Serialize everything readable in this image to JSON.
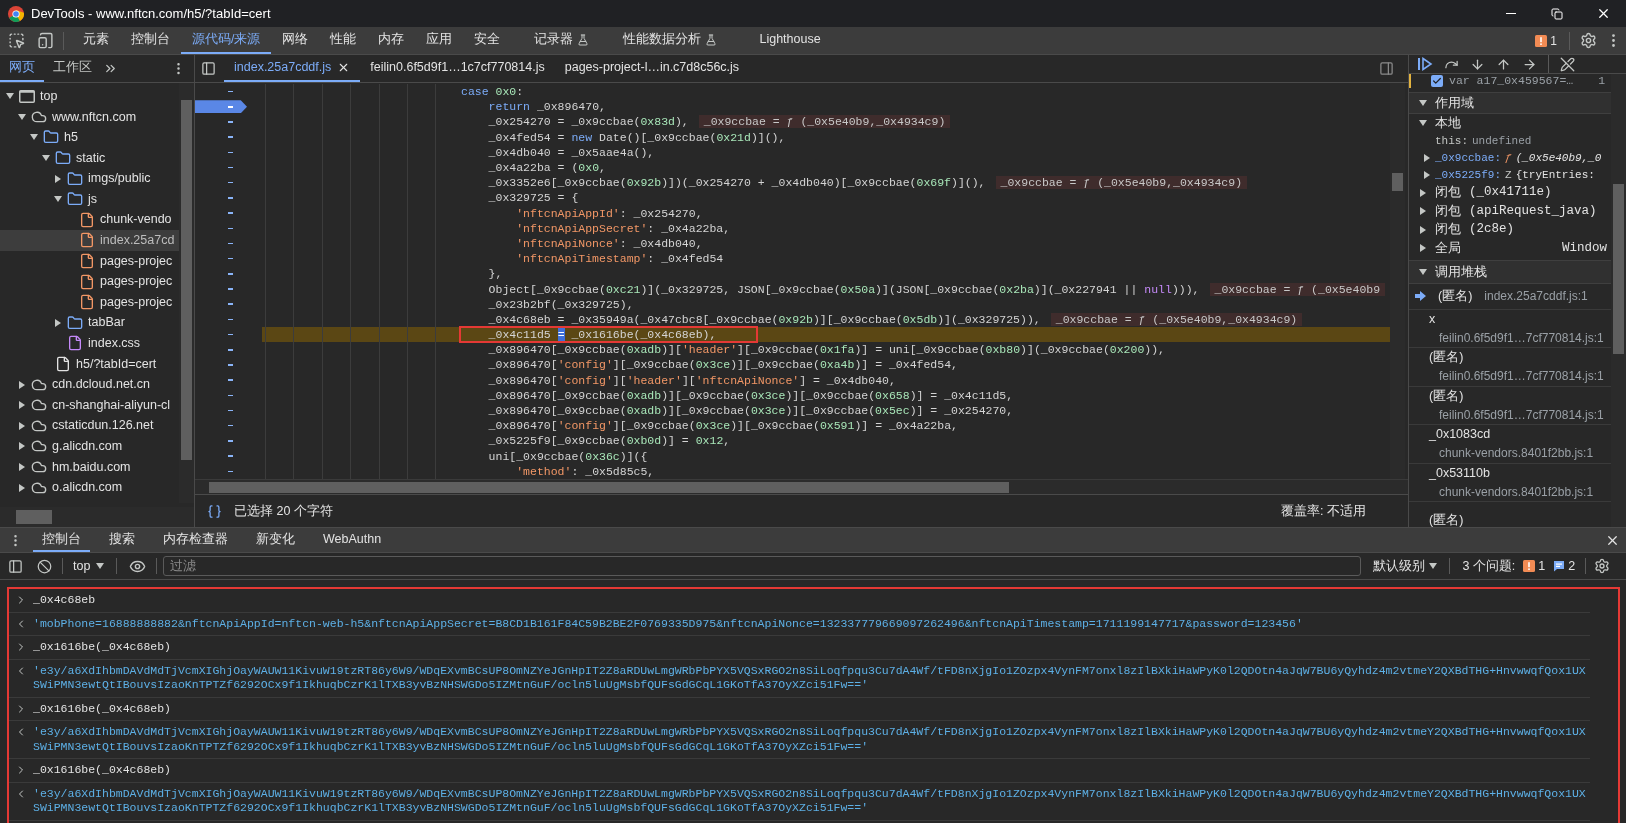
{
  "window": {
    "title": "DevTools - www.nftcn.com/h5/?tabId=cert"
  },
  "main_tabs": [
    {
      "label": "元素",
      "selected": false,
      "experimental": false
    },
    {
      "label": "控制台",
      "selected": false,
      "experimental": false
    },
    {
      "label": "源代码/来源",
      "selected": true,
      "experimental": false
    },
    {
      "label": "网络",
      "selected": false,
      "experimental": false
    },
    {
      "label": "性能",
      "selected": false,
      "experimental": false
    },
    {
      "label": "内存",
      "selected": false,
      "experimental": false
    },
    {
      "label": "应用",
      "selected": false,
      "experimental": false
    },
    {
      "label": "安全",
      "selected": false,
      "experimental": false
    },
    {
      "label": "记录器",
      "selected": false,
      "experimental": true
    },
    {
      "label": "性能数据分析",
      "selected": false,
      "experimental": true
    },
    {
      "label": "Lighthouse",
      "selected": false,
      "experimental": false
    }
  ],
  "issues_badge": {
    "count": "1"
  },
  "navigator": {
    "tabs": [
      {
        "label": "网页",
        "selected": true
      },
      {
        "label": "工作区",
        "selected": false
      }
    ],
    "tree": [
      {
        "kind": "frame",
        "label": "top",
        "expanded": true,
        "selected": false,
        "children": [
          {
            "kind": "domain",
            "label": "www.nftcn.com",
            "expanded": true,
            "selected": false,
            "children": [
              {
                "kind": "folder",
                "label": "h5",
                "expanded": true,
                "selected": false,
                "children": [
                  {
                    "kind": "folder",
                    "label": "static",
                    "expanded": true,
                    "selected": false,
                    "children": [
                      {
                        "kind": "folder",
                        "label": "imgs/public",
                        "expanded": false,
                        "selected": false
                      },
                      {
                        "kind": "folder",
                        "label": "js",
                        "expanded": true,
                        "selected": false,
                        "children": [
                          {
                            "kind": "script",
                            "label": "chunk-vendo",
                            "selected": false
                          },
                          {
                            "kind": "script",
                            "label": "index.25a7cd",
                            "selected": true
                          },
                          {
                            "kind": "script",
                            "label": "pages-projec",
                            "selected": false
                          },
                          {
                            "kind": "script",
                            "label": "pages-projec",
                            "selected": false
                          },
                          {
                            "kind": "script",
                            "label": "pages-projec",
                            "selected": false
                          }
                        ]
                      },
                      {
                        "kind": "folder",
                        "label": "tabBar",
                        "expanded": false,
                        "selected": false
                      },
                      {
                        "kind": "stylesheet",
                        "label": "index.css",
                        "selected": false
                      }
                    ]
                  },
                  {
                    "kind": "document",
                    "label": "h5/?tabId=cert",
                    "selected": false
                  }
                ]
              }
            ]
          },
          {
            "kind": "domain",
            "label": "cdn.dcloud.net.cn",
            "expanded": false,
            "selected": false
          },
          {
            "kind": "domain",
            "label": "cn-shanghai-aliyun-cl",
            "expanded": false,
            "selected": false
          },
          {
            "kind": "domain",
            "label": "cstaticdun.126.net",
            "expanded": false,
            "selected": false
          },
          {
            "kind": "domain",
            "label": "g.alicdn.com",
            "expanded": false,
            "selected": false
          },
          {
            "kind": "domain",
            "label": "hm.baidu.com",
            "expanded": false,
            "selected": false
          },
          {
            "kind": "domain",
            "label": "o.alicdn.com",
            "expanded": false,
            "selected": false
          }
        ]
      }
    ]
  },
  "editor": {
    "tabs": [
      {
        "label": "index.25a7cddf.js",
        "selected": true
      },
      {
        "label": "feilin0.6f5d9f1…1c7cf770814.js",
        "selected": false
      },
      {
        "label": "pages-project-l…in.c7d8c56c.js",
        "selected": false
      }
    ],
    "lines": [
      {
        "tokens": [
          {
            "kind": "keyword",
            "text": "case "
          },
          {
            "kind": "number",
            "text": "0x0"
          },
          {
            "kind": "plain",
            "text": ":"
          }
        ]
      },
      {
        "breakpoint": true,
        "tokens": [
          {
            "kind": "keyword",
            "text": "    return"
          },
          {
            "kind": "plain",
            "text": " _0x896470,"
          }
        ]
      },
      {
        "tokens": [
          {
            "kind": "plain",
            "text": "    _0x254270 = _0x9ccbae("
          },
          {
            "kind": "number",
            "text": "0x83d"
          },
          {
            "kind": "plain",
            "text": "),"
          }
        ],
        "value": "_0x9ccbae = ƒ (_0x5e40b9,_0x4934c9)"
      },
      {
        "tokens": [
          {
            "kind": "plain",
            "text": "    _0x4fed54 = "
          },
          {
            "kind": "keyword",
            "text": "new"
          },
          {
            "kind": "plain",
            "text": " Date()[_0x9ccbae("
          },
          {
            "kind": "number",
            "text": "0x21d"
          },
          {
            "kind": "plain",
            "text": ")](),"
          }
        ]
      },
      {
        "tokens": [
          {
            "kind": "plain",
            "text": "    _0x4db040 = _0x5aae4a(),"
          }
        ]
      },
      {
        "tokens": [
          {
            "kind": "plain",
            "text": "    _0x4a22ba = ("
          },
          {
            "kind": "number",
            "text": "0x0"
          },
          {
            "kind": "plain",
            "text": ","
          }
        ]
      },
      {
        "tokens": [
          {
            "kind": "plain",
            "text": "    _0x3352e6[_0x9ccbae("
          },
          {
            "kind": "number",
            "text": "0x92b"
          },
          {
            "kind": "plain",
            "text": ")])(_0x254270 + _0x4db040)[_0x9ccbae("
          },
          {
            "kind": "number",
            "text": "0x69f"
          },
          {
            "kind": "plain",
            "text": ")](),"
          }
        ],
        "value": "_0x9ccbae = ƒ (_0x5e40b9,_0x4934c9)"
      },
      {
        "tokens": [
          {
            "kind": "plain",
            "text": "    _0x329725 = {"
          }
        ]
      },
      {
        "tokens": [
          {
            "kind": "string",
            "text": "        'nftcnApiAppId'"
          },
          {
            "kind": "plain",
            "text": ": _0x254270,"
          }
        ]
      },
      {
        "tokens": [
          {
            "kind": "string",
            "text": "        'nftcnApiAppSecret'"
          },
          {
            "kind": "plain",
            "text": ": _0x4a22ba,"
          }
        ]
      },
      {
        "tokens": [
          {
            "kind": "string",
            "text": "        'nftcnApiNonce'"
          },
          {
            "kind": "plain",
            "text": ": _0x4db040,"
          }
        ]
      },
      {
        "tokens": [
          {
            "kind": "string",
            "text": "        'nftcnApiTimestamp'"
          },
          {
            "kind": "plain",
            "text": ": _0x4fed54"
          }
        ]
      },
      {
        "tokens": [
          {
            "kind": "plain",
            "text": "    },"
          }
        ]
      },
      {
        "tokens": [
          {
            "kind": "plain",
            "text": "    Object[_0x9ccbae("
          },
          {
            "kind": "number",
            "text": "0xc21"
          },
          {
            "kind": "plain",
            "text": ")](_0x329725, JSON[_0x9ccbae("
          },
          {
            "kind": "number",
            "text": "0x50a"
          },
          {
            "kind": "plain",
            "text": ")](JSON[_0x9ccbae("
          },
          {
            "kind": "number",
            "text": "0x2ba"
          },
          {
            "kind": "plain",
            "text": ")](_0x227941 || "
          },
          {
            "kind": "null",
            "text": "null"
          },
          {
            "kind": "plain",
            "text": "))),"
          }
        ],
        "value": "_0x9ccbae = ƒ (_0x5e40b9"
      },
      {
        "tokens": [
          {
            "kind": "plain",
            "text": "    _0x23b2bf(_0x329725),"
          }
        ]
      },
      {
        "tokens": [
          {
            "kind": "plain",
            "text": "    _0x4c68eb = _0x35949a(_0x47cbc8[_0x9ccbae("
          },
          {
            "kind": "number",
            "text": "0x92b"
          },
          {
            "kind": "plain",
            "text": ")][_0x9ccbae("
          },
          {
            "kind": "number",
            "text": "0x5db"
          },
          {
            "kind": "plain",
            "text": ")](_0x329725)),"
          }
        ],
        "value": "_0x9ccbae = ƒ (_0x5e40b9,_0x4934c9)"
      },
      {
        "paused": true,
        "boxed": true,
        "tokens": [
          {
            "kind": "plain",
            "text": "    _0x4c11d5 "
          },
          {
            "kind": "selection",
            "text": "="
          },
          {
            "kind": "plain",
            "text": " _0x1616be(_0x4c68eb),"
          }
        ]
      },
      {
        "tokens": [
          {
            "kind": "plain",
            "text": "    _0x896470[_0x9ccbae("
          },
          {
            "kind": "number",
            "text": "0xadb"
          },
          {
            "kind": "plain",
            "text": ")]["
          },
          {
            "kind": "string",
            "text": "'header'"
          },
          {
            "kind": "plain",
            "text": "][_0x9ccbae("
          },
          {
            "kind": "number",
            "text": "0x1fa"
          },
          {
            "kind": "plain",
            "text": ")] = uni[_0x9ccbae("
          },
          {
            "kind": "number",
            "text": "0xb80"
          },
          {
            "kind": "plain",
            "text": ")](_0x9ccbae("
          },
          {
            "kind": "number",
            "text": "0x200"
          },
          {
            "kind": "plain",
            "text": ")),"
          }
        ]
      },
      {
        "tokens": [
          {
            "kind": "plain",
            "text": "    _0x896470["
          },
          {
            "kind": "string",
            "text": "'config'"
          },
          {
            "kind": "plain",
            "text": "][_0x9ccbae("
          },
          {
            "kind": "number",
            "text": "0x3ce"
          },
          {
            "kind": "plain",
            "text": ")][_0x9ccbae("
          },
          {
            "kind": "number",
            "text": "0xa4b"
          },
          {
            "kind": "plain",
            "text": ")] = _0x4fed54,"
          }
        ]
      },
      {
        "tokens": [
          {
            "kind": "plain",
            "text": "    _0x896470["
          },
          {
            "kind": "string",
            "text": "'config'"
          },
          {
            "kind": "plain",
            "text": "]["
          },
          {
            "kind": "string",
            "text": "'header'"
          },
          {
            "kind": "plain",
            "text": "]["
          },
          {
            "kind": "string",
            "text": "'nftcnApiNonce'"
          },
          {
            "kind": "plain",
            "text": "] = _0x4db040,"
          }
        ]
      },
      {
        "tokens": [
          {
            "kind": "plain",
            "text": "    _0x896470[_0x9ccbae("
          },
          {
            "kind": "number",
            "text": "0xadb"
          },
          {
            "kind": "plain",
            "text": ")][_0x9ccbae("
          },
          {
            "kind": "number",
            "text": "0x3ce"
          },
          {
            "kind": "plain",
            "text": ")][_0x9ccbae("
          },
          {
            "kind": "number",
            "text": "0x658"
          },
          {
            "kind": "plain",
            "text": ")] = _0x4c11d5,"
          }
        ]
      },
      {
        "tokens": [
          {
            "kind": "plain",
            "text": "    _0x896470[_0x9ccbae("
          },
          {
            "kind": "number",
            "text": "0xadb"
          },
          {
            "kind": "plain",
            "text": ")][_0x9ccbae("
          },
          {
            "kind": "number",
            "text": "0x3ce"
          },
          {
            "kind": "plain",
            "text": ")][_0x9ccbae("
          },
          {
            "kind": "number",
            "text": "0x5ec"
          },
          {
            "kind": "plain",
            "text": ")] = _0x254270,"
          }
        ]
      },
      {
        "tokens": [
          {
            "kind": "plain",
            "text": "    _0x896470["
          },
          {
            "kind": "string",
            "text": "'config'"
          },
          {
            "kind": "plain",
            "text": "][_0x9ccbae("
          },
          {
            "kind": "number",
            "text": "0x3ce"
          },
          {
            "kind": "plain",
            "text": ")][_0x9ccbae("
          },
          {
            "kind": "number",
            "text": "0x591"
          },
          {
            "kind": "plain",
            "text": ")] = _0x4a22ba,"
          }
        ]
      },
      {
        "tokens": [
          {
            "kind": "plain",
            "text": "    _0x5225f9[_0x9ccbae("
          },
          {
            "kind": "number",
            "text": "0xb0d"
          },
          {
            "kind": "plain",
            "text": ")] = "
          },
          {
            "kind": "number",
            "text": "0x12"
          },
          {
            "kind": "plain",
            "text": ","
          }
        ]
      },
      {
        "tokens": [
          {
            "kind": "plain",
            "text": "    uni[_0x9ccbae("
          },
          {
            "kind": "number",
            "text": "0x36c"
          },
          {
            "kind": "plain",
            "text": ")]({"
          }
        ]
      },
      {
        "tokens": [
          {
            "kind": "string",
            "text": "        'method'"
          },
          {
            "kind": "plain",
            "text": ": _0x5d85c5,"
          }
        ]
      }
    ],
    "selection": "已选择 20 个字符",
    "coverage": "覆盖率: 不适用"
  },
  "debugger": {
    "breakpoint": {
      "text": "var a17_0x459567=…",
      "checked": true,
      "line": "1"
    },
    "scope": {
      "title": "作用域",
      "expanded": true,
      "groups": [
        {
          "label": "本地",
          "expanded": true,
          "entries": [
            {
              "kind": "plain",
              "name": "this:",
              "value": "undefined"
            },
            {
              "kind": "function",
              "name": "_0x9ccbae:",
              "type": "ƒ",
              "value": "(_0x5e40b9,_0",
              "expanded": false
            },
            {
              "kind": "object",
              "name": "_0x5225f9:",
              "type": "Z",
              "value": "{tryEntries:",
              "expanded": false
            }
          ]
        },
        {
          "label": "闭包",
          "detail": "(_0x41711e)",
          "expanded": false
        },
        {
          "label": "闭包",
          "detail": "(apiRequest_java)",
          "expanded": false
        },
        {
          "label": "闭包",
          "detail": "(2c8e)",
          "expanded": false
        },
        {
          "label": "全局",
          "value": "Window",
          "expanded": false
        }
      ]
    },
    "call_stack": {
      "title": "调用堆栈",
      "expanded": true,
      "frames": [
        {
          "name": "(匿名)",
          "location": "index.25a7cddf.js:1",
          "selected": true
        },
        {
          "name": "x",
          "location": "feilin0.6f5d9f1…7cf770814.js:1",
          "selected": false
        },
        {
          "name": "(匿名)",
          "location": "feilin0.6f5d9f1…7cf770814.js:1",
          "selected": false
        },
        {
          "name": "(匿名)",
          "location": "feilin0.6f5d9f1…7cf770814.js:1",
          "selected": false
        },
        {
          "name": "_0x1083cd",
          "location": "chunk-vendors.8401f2bb.js:1",
          "selected": false
        },
        {
          "name": "_0x53110b",
          "location": "chunk-vendors.8401f2bb.js:1",
          "selected": false
        },
        {
          "name": "(匿名)",
          "selected": false
        }
      ]
    }
  },
  "drawer": {
    "tabs": [
      {
        "label": "控制台",
        "selected": true
      },
      {
        "label": "搜索",
        "selected": false
      },
      {
        "label": "内存检查器",
        "selected": false
      },
      {
        "label": "新变化",
        "selected": false
      },
      {
        "label": "WebAuthn",
        "selected": false
      }
    ],
    "context": "top",
    "filter_placeholder": "过滤",
    "level": "默认级别",
    "issues_label": "3 个问题:",
    "issue_counts": [
      {
        "kind": "error",
        "count": "1"
      },
      {
        "kind": "info",
        "count": "2"
      }
    ],
    "boxed": true,
    "messages": [
      {
        "kind": "input",
        "text": "_0x4c68eb"
      },
      {
        "kind": "output",
        "text": "'mobPhone=16888888882&nftcnApiAppId=nftcn-web-h5&nftcnApiAppSecret=B8CD1B161F84C59B2BE2F0769335D975&nftcnApiNonce=132337779669097262496&nftcnApiTimestamp=1711199147717&password=123456'"
      },
      {
        "kind": "input",
        "text": "_0x1616be(_0x4c68eb)"
      },
      {
        "kind": "output",
        "text": "'e3y/a6XdIhbmDAVdMdTjVcmXIGhjOayWAUW11KivuW19tzRT86y6W9/WDqEXvmBCsUP8OmNZYeJGnHpIT2Z8aRDUwLmgWRbPbPYX5VQSxRGO2n8SiLoqfpqu3Cu7dA4Wf/tFD8nXjgIo1ZOzpx4VynFM7onxl8zIlBXkiHaWPyK0l2QDOtn4aJqW7BU6yQyhdz4m2vtmeY2QXBdTHG+HnvwwqfQox1UXSWiPMN3ewtQtIBouvsIzaoKnTPTZf6292OCx9f1IkhuqbCzrK1lTXB3yvBzNHSWGDo5IZMtnGuF/ocln5luUgMsbfQUFsGdGCqL1GKoTfA37OyXZci51Fw=='"
      },
      {
        "kind": "input",
        "text": "_0x1616be(_0x4c68eb)"
      },
      {
        "kind": "output",
        "text": "'e3y/a6XdIhbmDAVdMdTjVcmXIGhjOayWAUW11KivuW19tzRT86y6W9/WDqEXvmBCsUP8OmNZYeJGnHpIT2Z8aRDUwLmgWRbPbPYX5VQSxRGO2n8SiLoqfpqu3Cu7dA4Wf/tFD8nXjgIo1ZOzpx4VynFM7onxl8zIlBXkiHaWPyK0l2QDOtn4aJqW7BU6yQyhdz4m2vtmeY2QXBdTHG+HnvwwqfQox1UXSWiPMN3ewtQtIBouvsIzaoKnTPTZf6292OCx9f1IkhuqbCzrK1lTXB3yvBzNHSWGDo5IZMtnGuF/ocln5luUgMsbfQUFsGdGCqL1GKoTfA37OyXZci51Fw=='"
      },
      {
        "kind": "input",
        "text": "_0x1616be(_0x4c68eb)"
      },
      {
        "kind": "output",
        "text": "'e3y/a6XdIhbmDAVdMdTjVcmXIGhjOayWAUW11KivuW19tzRT86y6W9/WDqEXvmBCsUP8OmNZYeJGnHpIT2Z8aRDUwLmgWRbPbPYX5VQSxRGO2n8SiLoqfpqu3Cu7dA4Wf/tFD8nXjgIo1ZOzpx4VynFM7onxl8zIlBXkiHaWPyK0l2QDOtn4aJqW7BU6yQyhdz4m2vtmeY2QXBdTHG+HnvwwqfQox1UXSWiPMN3ewtQtIBouvsIzaoKnTPTZf6292OCx9f1IkhuqbCzrK1lTXB3yvBzNHSWGDo5IZMtnGuF/ocln5luUgMsbfQUFsGdGCqL1GKoTfA37OyXZci51Fw=='"
      }
    ]
  }
}
